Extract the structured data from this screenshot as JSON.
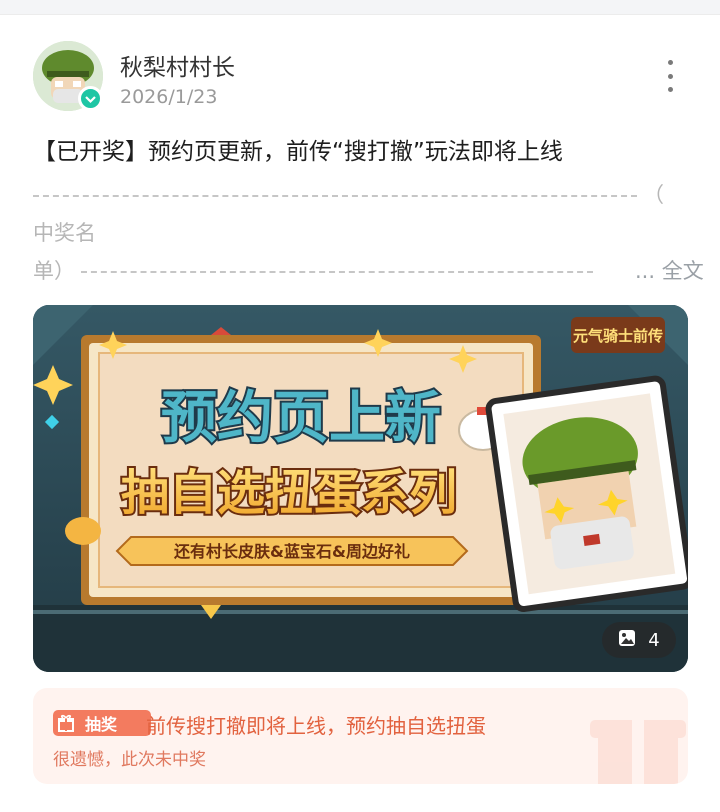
{
  "post": {
    "author": "秋梨村村长",
    "date": "2026/1/23",
    "title": "【已开奖】预约页更新，前传“搜打撤”玩法即将上线",
    "body_line1_tail": "（",
    "body_line2": "中奖名",
    "body_line3_head": "单）",
    "full_text_link": "... 全文"
  },
  "banner": {
    "logo_text": "元气骑士前传",
    "headline": "预约页上新",
    "subheadline": "抽自选扭蛋系列",
    "ribbon": "还有村长皮肤&蓝宝石&周边好礼",
    "image_count": "4"
  },
  "lottery": {
    "tag_label": "抽奖",
    "prize_text": "前传搜打撤即将上线，预约抽自选扭蛋",
    "result_text": "很遗憾，此次未中奖"
  },
  "colors": {
    "accent": "#f37b5f",
    "verified": "#1ec6a4",
    "banner_bg": "#2d4a56"
  },
  "icons": [
    "verified-icon",
    "more-icon",
    "image-count-icon",
    "gift-icon"
  ]
}
